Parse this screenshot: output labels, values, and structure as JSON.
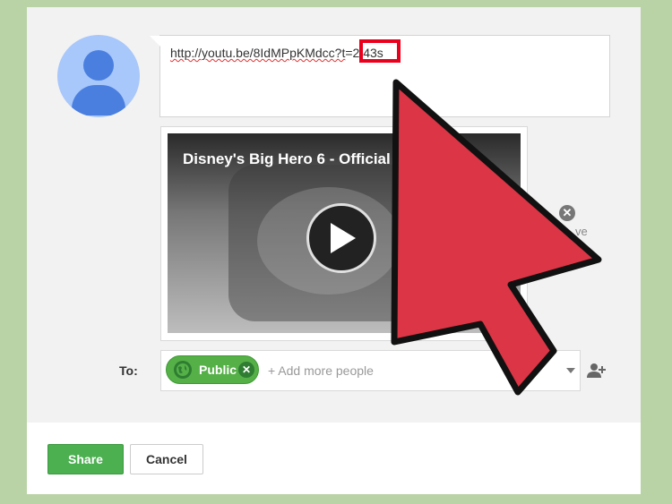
{
  "post": {
    "url_prefix": "http://youtu.be/8IdMPpKMdcc?t",
    "time_param": "=2:43s"
  },
  "video": {
    "title": "Disney's Big Hero 6 - Official U",
    "remove_label": "ve"
  },
  "audience": {
    "to_label": "To:",
    "chip_label": "Public",
    "add_placeholder": "+ Add more people"
  },
  "actions": {
    "share_label": "Share",
    "cancel_label": "Cancel"
  },
  "icons": {
    "avatar": "user-avatar-icon",
    "play": "play-icon",
    "remove": "close-circle-icon",
    "globe": "globe-icon",
    "chip_remove": "close-icon",
    "dropdown": "chevron-down-icon",
    "add_person": "add-person-icon",
    "pointer": "red-arrow-pointer"
  },
  "colors": {
    "background": "#b9d3a6",
    "chip": "#56b048",
    "share_button": "#4caf50",
    "highlight_box": "#e8001c",
    "arrow_fill": "#dc3545"
  }
}
